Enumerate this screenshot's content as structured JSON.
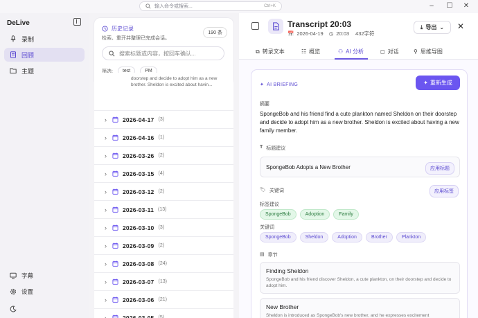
{
  "command_bar": {
    "placeholder": "输入命令或搜索...",
    "shortcut": "Ctrl+K"
  },
  "app": {
    "name": "DeLive"
  },
  "sidebar": {
    "items": [
      {
        "label": "录制",
        "icon": "mic-icon"
      },
      {
        "label": "回顾",
        "icon": "review-icon"
      },
      {
        "label": "主题",
        "icon": "folder-icon"
      }
    ],
    "bottom": [
      {
        "label": "字幕",
        "icon": "monitor-icon"
      },
      {
        "label": "设置",
        "icon": "gear-icon"
      }
    ]
  },
  "history": {
    "title": "历史记录",
    "subtitle": "检索、重开并整理已完成会话。",
    "count": "190 条",
    "search_placeholder": "搜索标题或内容，按回车确认...",
    "filter_label": "筛选:",
    "filters": [
      "test",
      "PM"
    ],
    "preview": "doorstep and decide to adopt him as a new brother. Sheldon is excited about havin...",
    "entries": [
      {
        "date": "2026-04-17",
        "count": "(3)"
      },
      {
        "date": "2026-04-16",
        "count": "(1)"
      },
      {
        "date": "2026-03-26",
        "count": "(2)"
      },
      {
        "date": "2026-03-15",
        "count": "(4)"
      },
      {
        "date": "2026-03-12",
        "count": "(2)"
      },
      {
        "date": "2026-03-11",
        "count": "(13)"
      },
      {
        "date": "2026-03-10",
        "count": "(3)"
      },
      {
        "date": "2026-03-09",
        "count": "(2)"
      },
      {
        "date": "2026-03-08",
        "count": "(24)"
      },
      {
        "date": "2026-03-07",
        "count": "(13)"
      },
      {
        "date": "2026-03-06",
        "count": "(21)"
      },
      {
        "date": "2026-03-05",
        "count": "(5)"
      }
    ]
  },
  "detail": {
    "title": "Transcript 20:03",
    "date": "2026-04-19",
    "time": "20:03",
    "chars": "432字符",
    "export_label": "导出",
    "tabs": [
      "转录文本",
      "概览",
      "AI 分析",
      "对话",
      "思维导图"
    ],
    "active_tab": "AI 分析",
    "ai": {
      "label": "AI BRIEFING",
      "regenerate": "重新生成",
      "summary_label": "摘要",
      "summary": "SpongeBob and his friend find a cute plankton named Sheldon on their doorstep and decide to adopt him as a new brother. Sheldon is excited about having a new family member.",
      "title_suggest_label": "标题建议",
      "title_suggest": "SpongeBob Adopts a New Brother",
      "apply_title": "应用标题",
      "keywords_label": "关键词",
      "apply_tags": "应用标签",
      "tag_suggest_label": "标签建议",
      "tag_suggestions": [
        "SpongeBob",
        "Adoption",
        "Family"
      ],
      "keywords_sub_label": "关键词",
      "keywords": [
        "SpongeBob",
        "Sheldon",
        "Adoption",
        "Brother",
        "Plankton"
      ],
      "chapters_label": "章节",
      "chapters": [
        {
          "title": "Finding Sheldon",
          "desc": "SpongeBob and his friend discover Sheldon, a cute plankton, on their doorstep and decide to adopt him."
        },
        {
          "title": "New Brother",
          "desc": "Sheldon is introduced as SpongeBob's new brother, and he expresses excitement"
        }
      ]
    }
  },
  "colors": {
    "accent": "#6b56f0",
    "green_tag": "#2a7a3e"
  }
}
